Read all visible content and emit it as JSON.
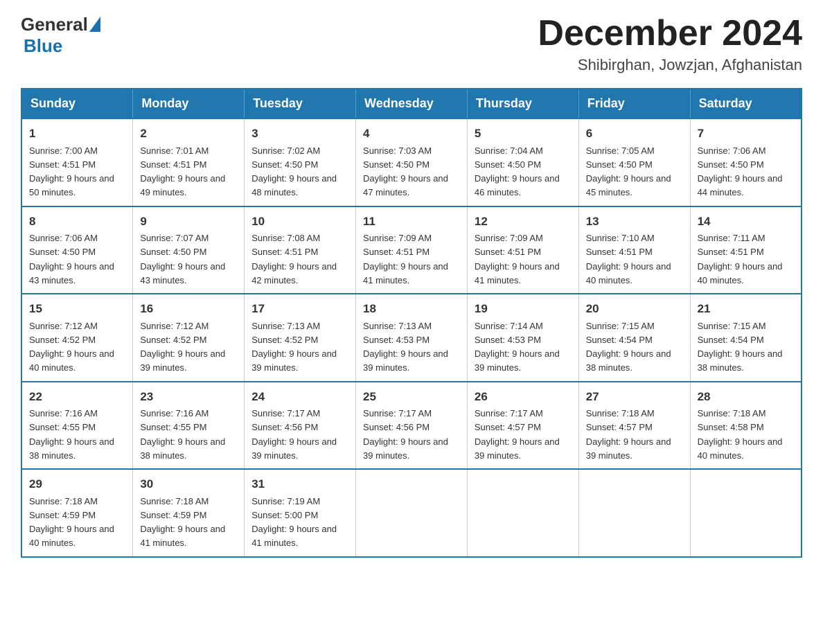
{
  "header": {
    "logo": {
      "general": "General",
      "blue": "Blue"
    },
    "title": "December 2024",
    "subtitle": "Shibirghan, Jowzjan, Afghanistan"
  },
  "weekdays": [
    "Sunday",
    "Monday",
    "Tuesday",
    "Wednesday",
    "Thursday",
    "Friday",
    "Saturday"
  ],
  "weeks": [
    [
      {
        "day": "1",
        "sunrise": "7:00 AM",
        "sunset": "4:51 PM",
        "daylight": "9 hours and 50 minutes."
      },
      {
        "day": "2",
        "sunrise": "7:01 AM",
        "sunset": "4:51 PM",
        "daylight": "9 hours and 49 minutes."
      },
      {
        "day": "3",
        "sunrise": "7:02 AM",
        "sunset": "4:50 PM",
        "daylight": "9 hours and 48 minutes."
      },
      {
        "day": "4",
        "sunrise": "7:03 AM",
        "sunset": "4:50 PM",
        "daylight": "9 hours and 47 minutes."
      },
      {
        "day": "5",
        "sunrise": "7:04 AM",
        "sunset": "4:50 PM",
        "daylight": "9 hours and 46 minutes."
      },
      {
        "day": "6",
        "sunrise": "7:05 AM",
        "sunset": "4:50 PM",
        "daylight": "9 hours and 45 minutes."
      },
      {
        "day": "7",
        "sunrise": "7:06 AM",
        "sunset": "4:50 PM",
        "daylight": "9 hours and 44 minutes."
      }
    ],
    [
      {
        "day": "8",
        "sunrise": "7:06 AM",
        "sunset": "4:50 PM",
        "daylight": "9 hours and 43 minutes."
      },
      {
        "day": "9",
        "sunrise": "7:07 AM",
        "sunset": "4:50 PM",
        "daylight": "9 hours and 43 minutes."
      },
      {
        "day": "10",
        "sunrise": "7:08 AM",
        "sunset": "4:51 PM",
        "daylight": "9 hours and 42 minutes."
      },
      {
        "day": "11",
        "sunrise": "7:09 AM",
        "sunset": "4:51 PM",
        "daylight": "9 hours and 41 minutes."
      },
      {
        "day": "12",
        "sunrise": "7:09 AM",
        "sunset": "4:51 PM",
        "daylight": "9 hours and 41 minutes."
      },
      {
        "day": "13",
        "sunrise": "7:10 AM",
        "sunset": "4:51 PM",
        "daylight": "9 hours and 40 minutes."
      },
      {
        "day": "14",
        "sunrise": "7:11 AM",
        "sunset": "4:51 PM",
        "daylight": "9 hours and 40 minutes."
      }
    ],
    [
      {
        "day": "15",
        "sunrise": "7:12 AM",
        "sunset": "4:52 PM",
        "daylight": "9 hours and 40 minutes."
      },
      {
        "day": "16",
        "sunrise": "7:12 AM",
        "sunset": "4:52 PM",
        "daylight": "9 hours and 39 minutes."
      },
      {
        "day": "17",
        "sunrise": "7:13 AM",
        "sunset": "4:52 PM",
        "daylight": "9 hours and 39 minutes."
      },
      {
        "day": "18",
        "sunrise": "7:13 AM",
        "sunset": "4:53 PM",
        "daylight": "9 hours and 39 minutes."
      },
      {
        "day": "19",
        "sunrise": "7:14 AM",
        "sunset": "4:53 PM",
        "daylight": "9 hours and 39 minutes."
      },
      {
        "day": "20",
        "sunrise": "7:15 AM",
        "sunset": "4:54 PM",
        "daylight": "9 hours and 38 minutes."
      },
      {
        "day": "21",
        "sunrise": "7:15 AM",
        "sunset": "4:54 PM",
        "daylight": "9 hours and 38 minutes."
      }
    ],
    [
      {
        "day": "22",
        "sunrise": "7:16 AM",
        "sunset": "4:55 PM",
        "daylight": "9 hours and 38 minutes."
      },
      {
        "day": "23",
        "sunrise": "7:16 AM",
        "sunset": "4:55 PM",
        "daylight": "9 hours and 38 minutes."
      },
      {
        "day": "24",
        "sunrise": "7:17 AM",
        "sunset": "4:56 PM",
        "daylight": "9 hours and 39 minutes."
      },
      {
        "day": "25",
        "sunrise": "7:17 AM",
        "sunset": "4:56 PM",
        "daylight": "9 hours and 39 minutes."
      },
      {
        "day": "26",
        "sunrise": "7:17 AM",
        "sunset": "4:57 PM",
        "daylight": "9 hours and 39 minutes."
      },
      {
        "day": "27",
        "sunrise": "7:18 AM",
        "sunset": "4:57 PM",
        "daylight": "9 hours and 39 minutes."
      },
      {
        "day": "28",
        "sunrise": "7:18 AM",
        "sunset": "4:58 PM",
        "daylight": "9 hours and 40 minutes."
      }
    ],
    [
      {
        "day": "29",
        "sunrise": "7:18 AM",
        "sunset": "4:59 PM",
        "daylight": "9 hours and 40 minutes."
      },
      {
        "day": "30",
        "sunrise": "7:18 AM",
        "sunset": "4:59 PM",
        "daylight": "9 hours and 41 minutes."
      },
      {
        "day": "31",
        "sunrise": "7:19 AM",
        "sunset": "5:00 PM",
        "daylight": "9 hours and 41 minutes."
      },
      null,
      null,
      null,
      null
    ]
  ]
}
